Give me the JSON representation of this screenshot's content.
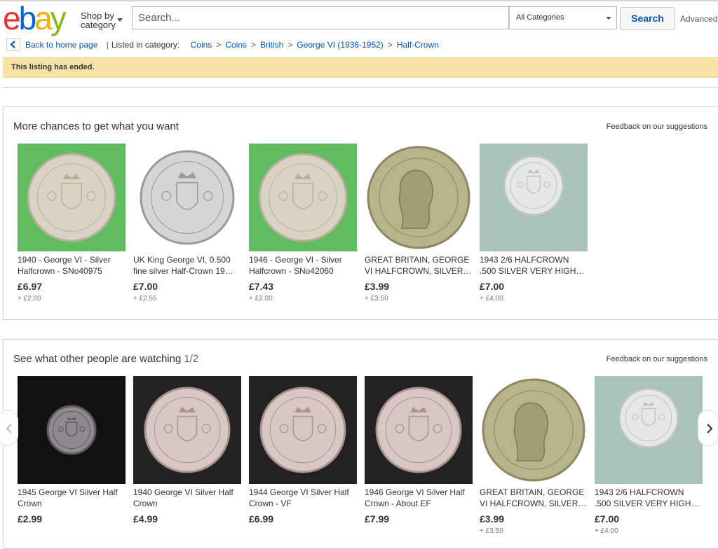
{
  "header": {
    "logo_letters": [
      "e",
      "b",
      "a",
      "y"
    ],
    "logo_colors": [
      "#e53238",
      "#0064d2",
      "#f5af02",
      "#86b817"
    ],
    "shop_by_line1": "Shop by",
    "shop_by_line2": "category",
    "search_placeholder": "Search...",
    "category_select": "All Categories",
    "search_button": "Search",
    "advanced_link": "Advanced"
  },
  "breadcrumb": {
    "back_label": "Back to home page",
    "listed_label": "Listed in category:",
    "items": [
      "Coins",
      "Coins",
      "British",
      "George VI (1936-1952)",
      "Half-Crown"
    ]
  },
  "notice": {
    "text": "This listing has ended."
  },
  "panel1": {
    "title": "More chances to get what you want",
    "feedback": "Feedback on our suggestions",
    "items": [
      {
        "title": "1940 - George VI - Silver Halfcrown - SNo40975",
        "price": "£6.97",
        "shipping": "+ £2.00",
        "bg": "#5fbd5f",
        "coin": "reverse",
        "stamp": "1940"
      },
      {
        "title": "UK King George VI, 0.500 fine silver Half-Crown 19…",
        "price": "£7.00",
        "shipping": "+ £2.55",
        "bg": "#ffffff",
        "coin": "reverse-grey",
        "stamp": "1946"
      },
      {
        "title": "1946 - George VI - Silver Halfcrown - SNo42060",
        "price": "£7.43",
        "shipping": "+ £2.00",
        "bg": "#5fbd5f",
        "coin": "reverse",
        "stamp": "1946"
      },
      {
        "title": "GREAT BRITAIN, GEORGE VI HALFCROWN, SILVER…",
        "price": "£3.99",
        "shipping": "+ £3.50",
        "bg": "#ffffff",
        "coin": "obverse",
        "stamp": ""
      },
      {
        "title": "1943 2/6 HALFCROWN .500 SILVER VERY HIGH…",
        "price": "£7.00",
        "shipping": "+ £4.00",
        "bg": "#aac3b8",
        "coin": "reverse-small",
        "stamp": "1943"
      }
    ]
  },
  "panel2": {
    "title": "See what other people are watching",
    "page": "1/2",
    "feedback": "Feedback on our suggestions",
    "items": [
      {
        "title": "1945 George VI Silver Half Crown",
        "price": "£2.99",
        "shipping": "",
        "bg": "#111111",
        "coin": "reverse-small-dark",
        "stamp": "1945"
      },
      {
        "title": "1940 George VI Silver Half Crown",
        "price": "£4.99",
        "shipping": "",
        "bg": "#222222",
        "coin": "reverse-pink",
        "stamp": "1940"
      },
      {
        "title": "1944 George VI Silver Half Crown - VF",
        "price": "£6.99",
        "shipping": "",
        "bg": "#222222",
        "coin": "reverse-pink",
        "stamp": "1944"
      },
      {
        "title": "1946 George VI Silver Half Crown - About EF",
        "price": "£7.99",
        "shipping": "",
        "bg": "#222222",
        "coin": "reverse-pink",
        "stamp": "1946"
      },
      {
        "title": "GREAT BRITAIN, GEORGE VI HALFCROWN, SILVER…",
        "price": "£3.99",
        "shipping": "+ £3.50",
        "bg": "#ffffff",
        "coin": "obverse",
        "stamp": ""
      },
      {
        "title": "1943 2/6 HALFCROWN .500 SILVER VERY HIGH…",
        "price": "£7.00",
        "shipping": "+ £4.00",
        "bg": "#aac3b8",
        "coin": "reverse-small",
        "stamp": "1943"
      }
    ]
  }
}
